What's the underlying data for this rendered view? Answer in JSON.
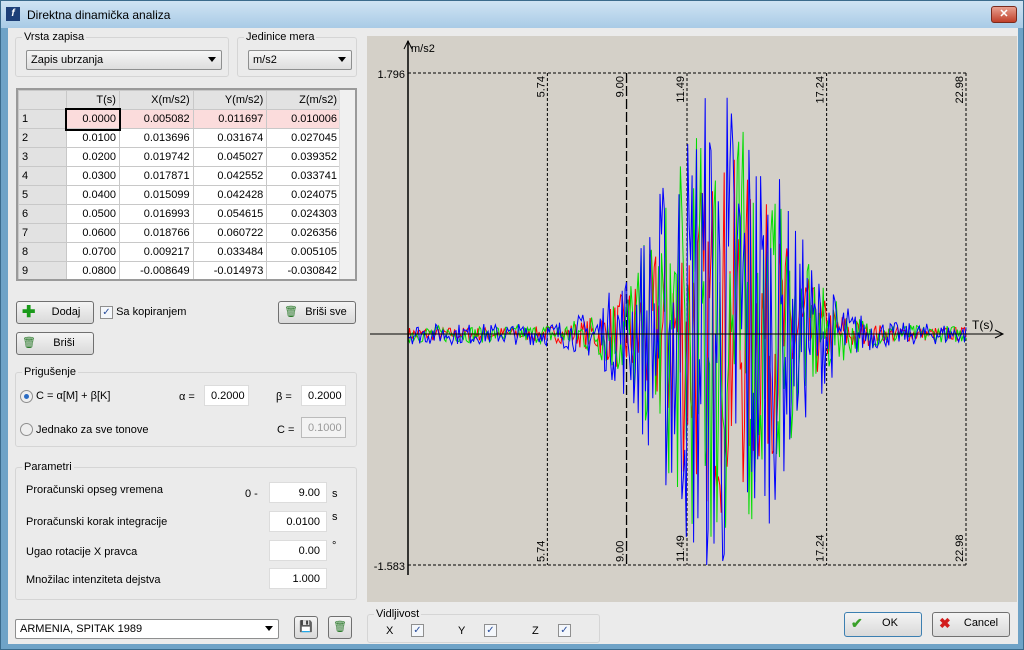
{
  "window": {
    "title": "Direktna dinamička analiza",
    "close_label": "✕"
  },
  "record_type": {
    "label": "Vrsta zapisa",
    "value": "Zapis ubrzanja"
  },
  "units": {
    "label": "Jedinice mera",
    "value": "m/s2"
  },
  "table": {
    "headers": [
      "",
      "T(s)",
      "X(m/s2)",
      "Y(m/s2)",
      "Z(m/s2)"
    ],
    "rows": [
      [
        "1",
        "0.0000",
        "0.005082",
        "0.011697",
        "0.010006"
      ],
      [
        "2",
        "0.0100",
        "0.013696",
        "0.031674",
        "0.027045"
      ],
      [
        "3",
        "0.0200",
        "0.019742",
        "0.045027",
        "0.039352"
      ],
      [
        "4",
        "0.0300",
        "0.017871",
        "0.042552",
        "0.033741"
      ],
      [
        "5",
        "0.0400",
        "0.015099",
        "0.042428",
        "0.024075"
      ],
      [
        "6",
        "0.0500",
        "0.016993",
        "0.054615",
        "0.024303"
      ],
      [
        "7",
        "0.0600",
        "0.018766",
        "0.060722",
        "0.026356"
      ],
      [
        "8",
        "0.0700",
        "0.009217",
        "0.033484",
        "0.005105"
      ],
      [
        "9",
        "0.0800",
        "-0.008649",
        "-0.014973",
        "-0.030842"
      ]
    ]
  },
  "buttons": {
    "add": "Dodaj",
    "copy_label": "Sa kopiranjem",
    "delete_all": "Briši sve",
    "delete": "Briši",
    "ok": "OK",
    "cancel": "Cancel"
  },
  "damping": {
    "label": "Prigušenje",
    "option1": "C = α[M] + β[K]",
    "option2": "Jednako za sve tonove",
    "alpha_label": "α =",
    "alpha": "0.2000",
    "beta_label": "β =",
    "beta": "0.2000",
    "c_label": "C =",
    "c": "0.1000"
  },
  "params": {
    "label": "Parametri",
    "time_range_label": "Proračunski opseg vremena",
    "time_range_prefix": "0 -",
    "time_range": "9.00",
    "time_unit": "s",
    "step_label": "Proračunski korak integracije",
    "step": "0.0100",
    "step_unit": "s",
    "rotation_label": "Ugao rotacije X pravca",
    "rotation": "0.00",
    "rotation_unit": "°",
    "intensity_label": "Množilac intenziteta dejstva",
    "intensity": "1.000"
  },
  "record_select": {
    "value": "ARMENIA, SPITAK 1989"
  },
  "visibility": {
    "label": "Vidljivost",
    "x": "X",
    "y": "Y",
    "z": "Z",
    "x_checked": true,
    "y_checked": true,
    "z_checked": true
  },
  "chart_data": {
    "type": "line",
    "ylabel": "m/s2",
    "xlabel": "T(s)",
    "ymax_label": "1.796",
    "ymin_label": "-1.583",
    "ylim": [
      -1.583,
      1.796
    ],
    "xlim": [
      0,
      22.98
    ],
    "time_markers": [
      "5.74",
      "9.00",
      "11.49",
      "17.24",
      "22.98"
    ],
    "calc_limit": "9.00",
    "series": [
      {
        "name": "X",
        "color": "#ff0000"
      },
      {
        "name": "Y",
        "color": "#00dd00"
      },
      {
        "name": "Z",
        "color": "#0000ff"
      }
    ]
  }
}
